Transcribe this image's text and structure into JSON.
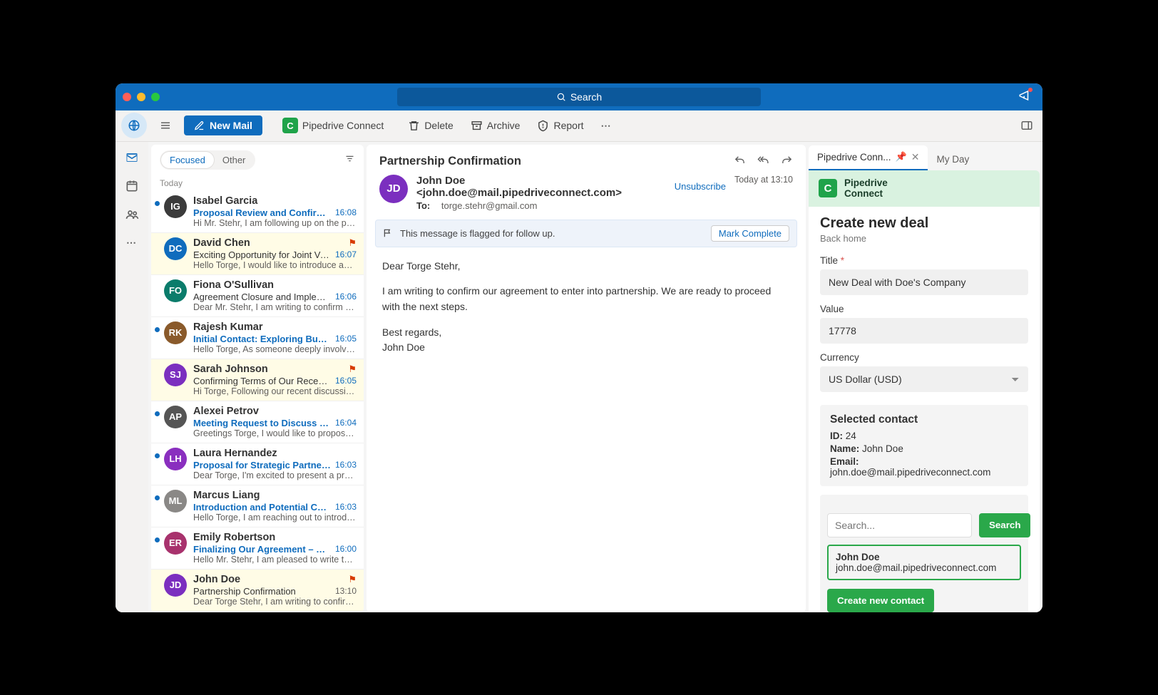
{
  "titlebar": {
    "search_placeholder": "Search"
  },
  "toolbar": {
    "new_mail": "New Mail",
    "pipedrive": "Pipedrive Connect",
    "delete": "Delete",
    "archive": "Archive",
    "report": "Report"
  },
  "list": {
    "tab_focused": "Focused",
    "tab_other": "Other",
    "section": "Today",
    "items": [
      {
        "initials": "IG",
        "color": "#3b3b3b",
        "sender": "Isabel Garcia",
        "subject": "Proposal Review and Confirmat...",
        "time": "16:08",
        "preview": "Hi Mr. Stehr, I am following up on the prop...",
        "unread": true,
        "flagged": false
      },
      {
        "initials": "DC",
        "color": "#0f6cbd",
        "sender": "David Chen",
        "subject": "Exciting Opportunity for Joint Ve...",
        "time": "16:07",
        "preview": "Hello Torge, I would like to introduce an e...",
        "unread": false,
        "flagged": true
      },
      {
        "initials": "FO",
        "color": "#0b7c6b",
        "sender": "Fiona O'Sullivan",
        "subject": "Agreement Closure and Impleme...",
        "time": "16:06",
        "preview": "Dear Mr. Stehr, I am writing to confirm the...",
        "unread": false,
        "flagged": false
      },
      {
        "initials": "RK",
        "color": "#8a5a2b",
        "sender": "Rajesh Kumar",
        "subject": "Initial Contact: Exploring Busin...",
        "time": "16:05",
        "preview": "Hello Torge, As someone deeply involved...",
        "unread": true,
        "flagged": false
      },
      {
        "initials": "SJ",
        "color": "#7b2fbf",
        "sender": "Sarah Johnson",
        "subject": "Confirming Terms of Our Recent...",
        "time": "16:05",
        "preview": "Hi Torge, Following our recent discussion...",
        "unread": false,
        "flagged": true
      },
      {
        "initials": "AP",
        "color": "#555555",
        "sender": "Alexei Petrov",
        "subject": "Meeting Request to Discuss Po...",
        "time": "16:04",
        "preview": "Greetings Torge, I would like to propose a...",
        "unread": true,
        "flagged": false
      },
      {
        "initials": "LH",
        "color": "#8a2fbf",
        "sender": "Laura Hernandez",
        "subject": "Proposal for Strategic Partners...",
        "time": "16:03",
        "preview": "Dear Torge, I'm excited to present a prop...",
        "unread": true,
        "flagged": false
      },
      {
        "initials": "ML",
        "color": "#8a8886",
        "sender": "Marcus Liang",
        "subject": "Introduction and Potential Coll...",
        "time": "16:03",
        "preview": "Hello Torge, I am reaching out to introduc...",
        "unread": true,
        "flagged": false
      },
      {
        "initials": "ER",
        "color": "#a8326d",
        "sender": "Emily Robertson",
        "subject": "Finalizing Our Agreement – Ne...",
        "time": "16:00",
        "preview": "Hello Mr. Stehr, I am pleased to write to y...",
        "unread": true,
        "flagged": false
      },
      {
        "initials": "JD",
        "color": "#7b2fbf",
        "sender": "John Doe",
        "subject": "Partnership Confirmation",
        "time": "13:10",
        "preview": "Dear Torge Stehr, I am writing to confirm...",
        "unread": false,
        "flagged": true,
        "time_read": true
      }
    ]
  },
  "message": {
    "subject": "Partnership Confirmation",
    "from_display": "John Doe <john.doe@mail.pipedriveconnect.com>",
    "unsubscribe": "Unsubscribe",
    "timestamp": "Today at 13:10",
    "to_label": "To:",
    "to_value": "torge.stehr@gmail.com",
    "banner_text": "This message is flagged for follow up.",
    "banner_action": "Mark Complete",
    "body_greeting": "Dear Torge Stehr,",
    "body_line1": "I am writing to confirm our agreement to enter into partnership. We are ready to proceed with the next steps.",
    "body_sign1": "Best regards,",
    "body_sign2": "John Doe",
    "avatar": "JD"
  },
  "rightpane": {
    "tab_active": "Pipedrive Conn...",
    "tab_myday": "My Day",
    "pd_brand": "Pipedrive\nConnect",
    "heading": "Create new deal",
    "back": "Back home",
    "label_title": "Title ",
    "title_value": "New Deal with Doe's Company",
    "label_value": "Value",
    "value_value": "17778",
    "label_currency": "Currency",
    "currency_value": "US Dollar (USD)",
    "contact_heading": "Selected contact",
    "contact_id_label": "ID:",
    "contact_id": "24",
    "contact_name_label": "Name:",
    "contact_name": "John Doe",
    "contact_email_label": "Email:",
    "contact_email": "john.doe@mail.pipedriveconnect.com",
    "search_placeholder": "Search...",
    "search_btn": "Search",
    "result_name": "John Doe",
    "result_email": "john.doe@mail.pipedriveconnect.com",
    "create_contact": "Create new contact"
  }
}
